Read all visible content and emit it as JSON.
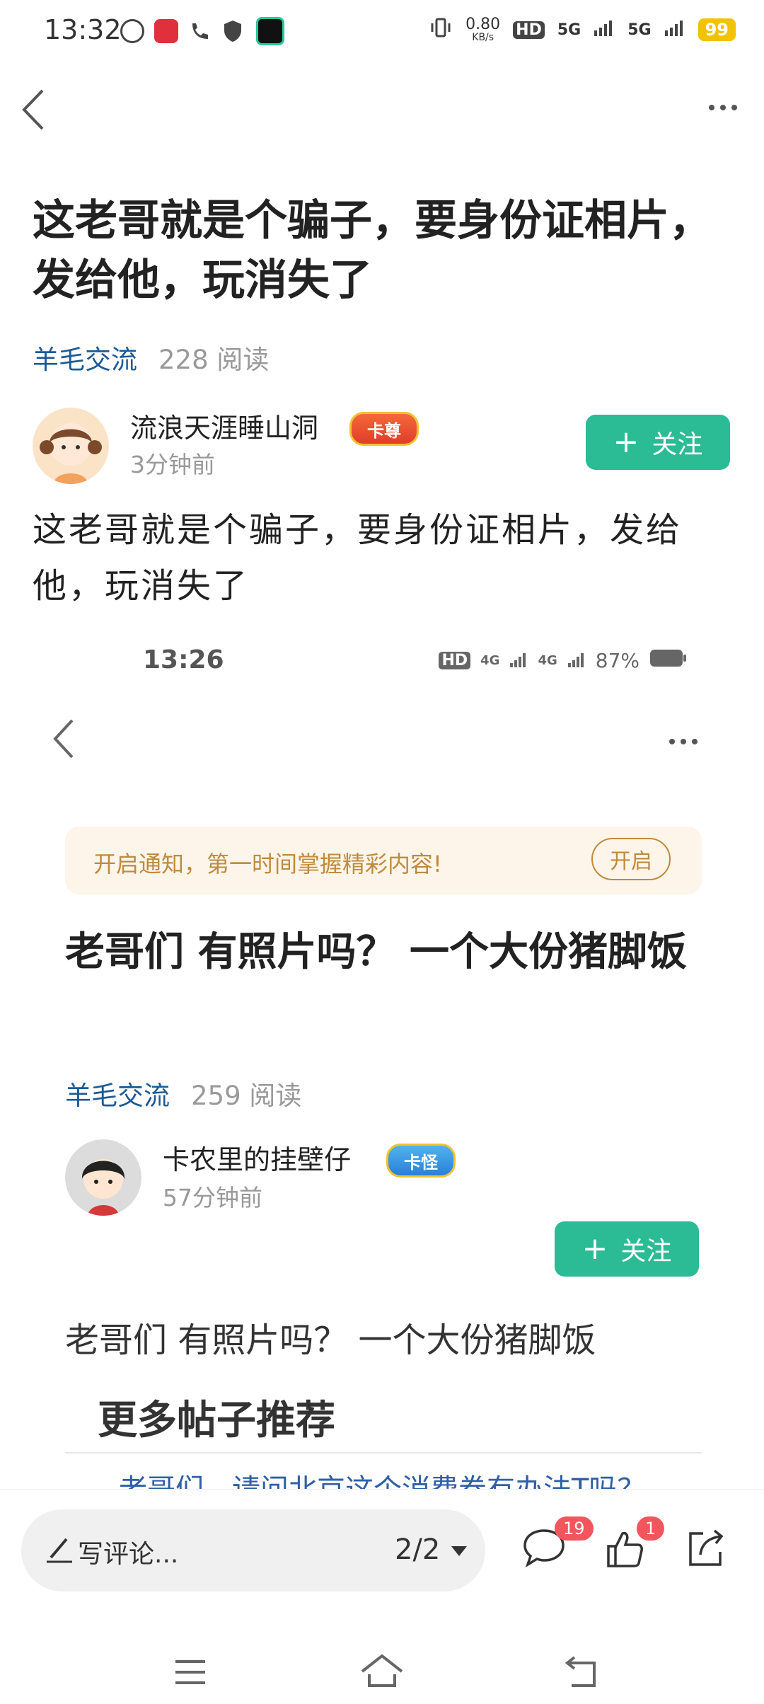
{
  "status_bar": {
    "time": "13:32",
    "net_speed": "0.80",
    "net_unit": "KB/s",
    "hd": "HD",
    "sim1": "5G",
    "sim2": "5G",
    "battery": "99"
  },
  "post": {
    "title": "这老哥就是个骗子，要身份证相片，发给他，玩消失了",
    "forum": "羊毛交流",
    "reads": "228 阅读",
    "author": "流浪天涯睡山洞",
    "badge": "卡尊",
    "time": "3分钟前",
    "follow_label": "关注",
    "body": "这老哥就是个骗子，要身份证相片，发给他，玩消失了"
  },
  "embedded_screenshot": {
    "status_time": "13:26",
    "status_hd": "HD",
    "status_sig1": "4G",
    "status_sig2": "4G",
    "battery": "87%",
    "notice_text": "开启通知，第一时间掌握精彩内容!",
    "notice_button": "开启",
    "title": "老哥们 有照片吗？ 一个大份猪脚饭",
    "forum": "羊毛交流",
    "reads": "259 阅读",
    "author": "卡农里的挂壁仔",
    "badge": "卡怪",
    "time": "57分钟前",
    "follow_label": "关注",
    "body": "老哥们 有照片吗？ 一个大份猪脚饭",
    "more_posts": "更多帖子推荐",
    "cut_link": "老哥们，请问北京这个消费券有办法T吗？"
  },
  "bottom_bar": {
    "comment_placeholder": "写评论...",
    "pager": "2/2",
    "comment_count": "19",
    "like_count": "1"
  },
  "colors": {
    "follow": "#2bbb95",
    "forum_link": "#1c5a96",
    "notice_bg": "#fdf5ea",
    "badge_red": "#f2555c",
    "battery": "#f2c200"
  }
}
